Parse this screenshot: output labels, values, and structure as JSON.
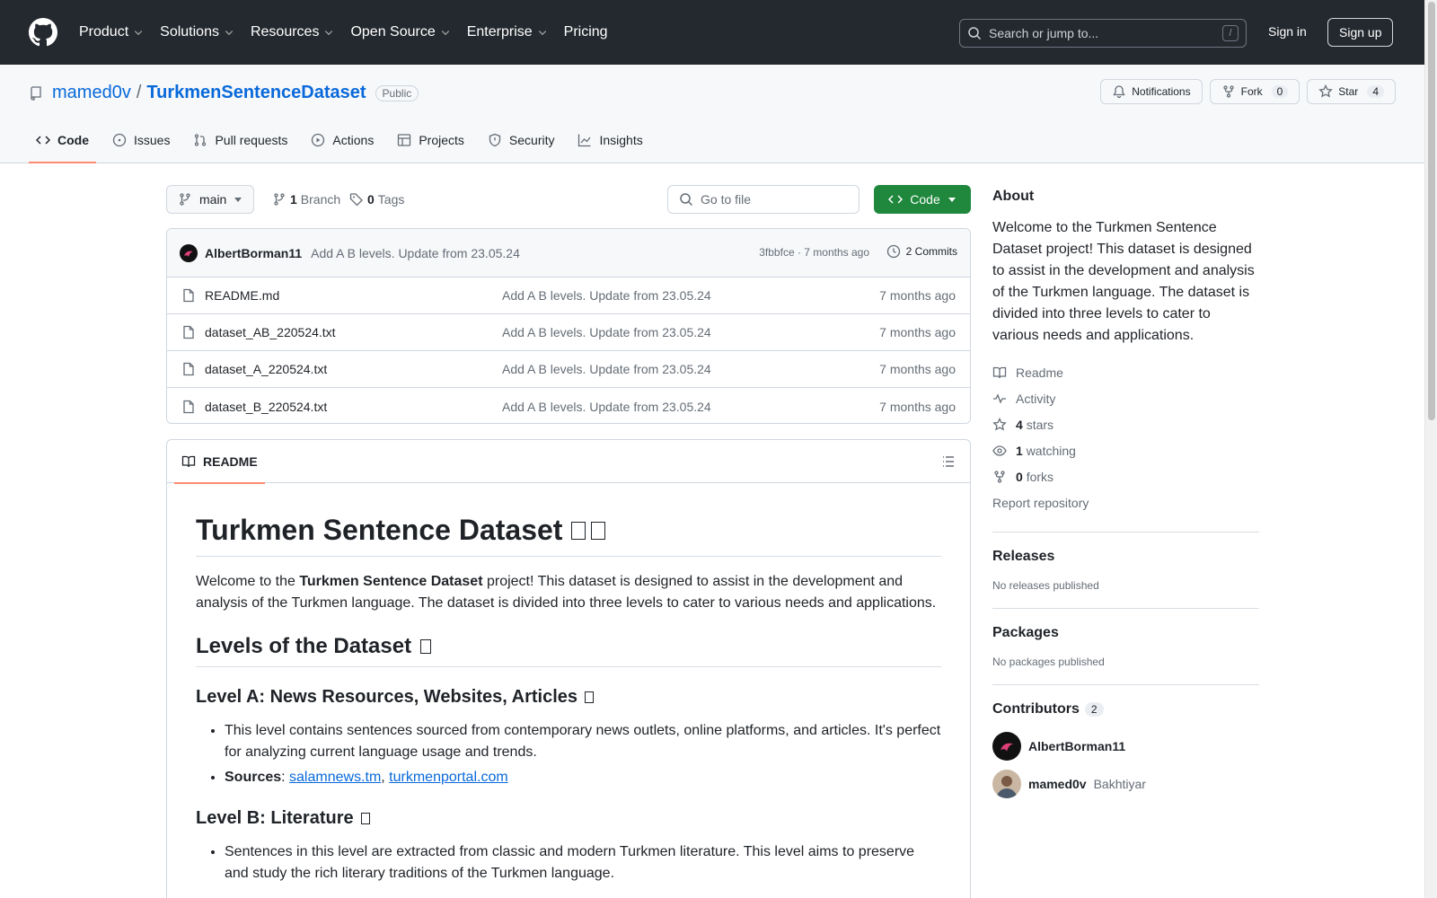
{
  "header": {
    "nav": [
      "Product",
      "Solutions",
      "Resources",
      "Open Source",
      "Enterprise",
      "Pricing"
    ],
    "search_placeholder": "Search or jump to...",
    "search_shortcut": "/",
    "sign_in": "Sign in",
    "sign_up": "Sign up"
  },
  "repo": {
    "owner": "mamed0v",
    "separator": "/",
    "name": "TurkmenSentenceDataset",
    "visibility": "Public",
    "notifications_label": "Notifications",
    "fork_label": "Fork",
    "fork_count": "0",
    "star_label": "Star",
    "star_count": "4",
    "tabs": [
      "Code",
      "Issues",
      "Pull requests",
      "Actions",
      "Projects",
      "Security",
      "Insights"
    ]
  },
  "toolbar": {
    "branch": "main",
    "branch_count": "1",
    "branch_label": "Branch",
    "tag_count": "0",
    "tag_label": "Tags",
    "goto_placeholder": "Go to file",
    "code_label": "Code"
  },
  "commit": {
    "author": "AlbertBorman11",
    "message": "Add A B levels. Update from 23.05.24",
    "meta": "3fbbfce · 7 months ago",
    "commits_label": "2 Commits"
  },
  "files": [
    {
      "name": "README.md",
      "message": "Add A B levels. Update from 23.05.24",
      "time": "7 months ago"
    },
    {
      "name": "dataset_AB_220524.txt",
      "message": "Add A B levels. Update from 23.05.24",
      "time": "7 months ago"
    },
    {
      "name": "dataset_A_220524.txt",
      "message": "Add A B levels. Update from 23.05.24",
      "time": "7 months ago"
    },
    {
      "name": "dataset_B_220524.txt",
      "message": "Add A B levels. Update from 23.05.24",
      "time": "7 months ago"
    }
  ],
  "readme": {
    "tab_label": "README",
    "h1": "Turkmen Sentence Dataset",
    "intro_before": "Welcome to the ",
    "intro_bold": "Turkmen Sentence Dataset",
    "intro_after": " project! This dataset is designed to assist in the development and analysis of the Turkmen language. The dataset is divided into three levels to cater to various needs and applications.",
    "h2_levels": "Levels of the Dataset",
    "h3_a": "Level A: News Resources, Websites, Articles",
    "a_item1": "This level contains sentences sourced from contemporary news outlets, online platforms, and articles. It's perfect for analyzing current language usage and trends.",
    "a_sources_label": "Sources",
    "a_sources_colon": ": ",
    "a_source1": "salamnews.tm",
    "a_source_comma": ", ",
    "a_source2": "turkmenportal.com",
    "h3_b": "Level B: Literature",
    "b_item1": "Sentences in this level are extracted from classic and modern Turkmen literature. This level aims to preserve and study the rich literary traditions of the Turkmen language."
  },
  "sidebar": {
    "about_title": "About",
    "about_desc": "Welcome to the Turkmen Sentence Dataset project! This dataset is designed to assist in the development and analysis of the Turkmen language. The dataset is divided into three levels to cater to various needs and applications.",
    "readme_link": "Readme",
    "activity_link": "Activity",
    "stars_count": "4",
    "stars_label": "stars",
    "watching_count": "1",
    "watching_label": "watching",
    "forks_count": "0",
    "forks_label": "forks",
    "report": "Report repository",
    "releases_title": "Releases",
    "releases_empty": "No releases published",
    "packages_title": "Packages",
    "packages_empty": "No packages published",
    "contributors_title": "Contributors",
    "contributors_count": "2",
    "contributors": [
      {
        "login": "AlbertBorman11",
        "name": ""
      },
      {
        "login": "mamed0v",
        "name": "Bakhtiyar"
      }
    ]
  }
}
